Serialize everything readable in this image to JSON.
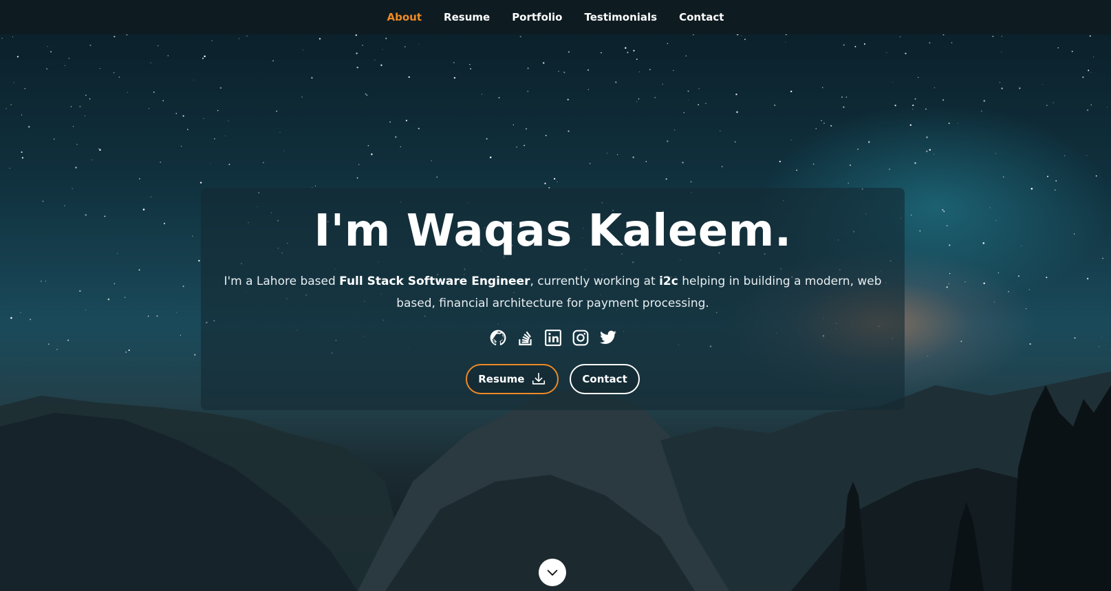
{
  "nav": {
    "items": [
      {
        "label": "About",
        "active": true
      },
      {
        "label": "Resume",
        "active": false
      },
      {
        "label": "Portfolio",
        "active": false
      },
      {
        "label": "Testimonials",
        "active": false
      },
      {
        "label": "Contact",
        "active": false
      }
    ]
  },
  "hero": {
    "headline": "I'm Waqas Kaleem.",
    "bio": {
      "prefix": "I'm a Lahore based ",
      "role": "Full Stack Software Engineer",
      "middle": ", currently working at ",
      "company": "i2c",
      "suffix": " helping in building a modern, web based, financial architecture for payment processing."
    },
    "socials": [
      {
        "icon": "github-icon"
      },
      {
        "icon": "stackoverflow-icon"
      },
      {
        "icon": "linkedin-icon"
      },
      {
        "icon": "instagram-icon"
      },
      {
        "icon": "twitter-icon"
      }
    ],
    "buttons": {
      "resume_label": "Resume",
      "resume_icon": "download-icon",
      "contact_label": "Contact"
    },
    "scroll_icon": "chevron-down-icon"
  },
  "colors": {
    "accent": "#f08a24",
    "nav_background": "#0f1c22",
    "text": "#ffffff"
  }
}
